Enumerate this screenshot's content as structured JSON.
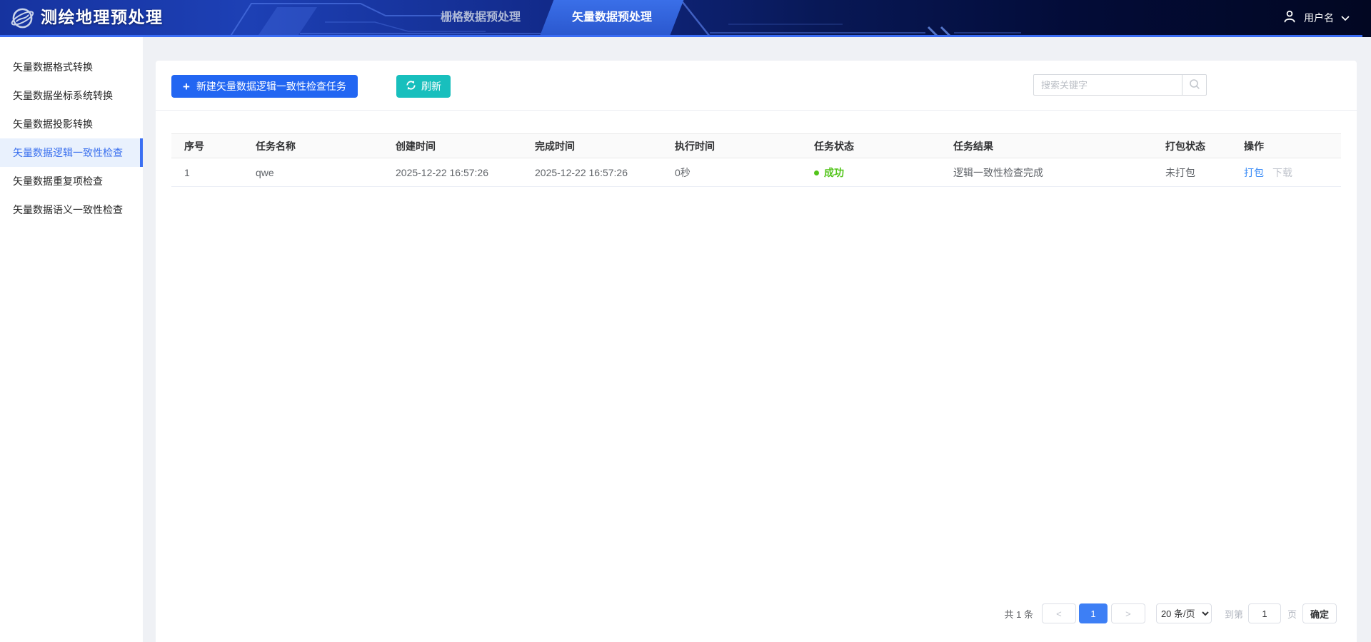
{
  "header": {
    "app_title": "测绘地理预处理",
    "tabs": [
      {
        "label": "栅格数据预处理",
        "active": false
      },
      {
        "label": "矢量数据预处理",
        "active": true
      }
    ],
    "user_name": "用户名"
  },
  "sidebar": {
    "items": [
      {
        "label": "矢量数据格式转换",
        "active": false
      },
      {
        "label": "矢量数据坐标系统转换",
        "active": false
      },
      {
        "label": "矢量数据投影转换",
        "active": false
      },
      {
        "label": "矢量数据逻辑一致性检查",
        "active": true
      },
      {
        "label": "矢量数据重复项检查",
        "active": false
      },
      {
        "label": "矢量数据语义一致性检查",
        "active": false
      }
    ]
  },
  "toolbar": {
    "new_task_label": "新建矢量数据逻辑一致性检查任务",
    "refresh_label": "刷新",
    "search_placeholder": "搜索关键字"
  },
  "table": {
    "columns": [
      "序号",
      "任务名称",
      "创建时间",
      "完成时间",
      "执行时间",
      "任务状态",
      "任务结果",
      "打包状态",
      "操作"
    ],
    "rows": [
      {
        "index": "1",
        "name": "qwe",
        "created_at": "2025-12-22 16:57:26",
        "finished_at": "2025-12-22 16:57:26",
        "duration": "0秒",
        "status": "成功",
        "result": "逻辑一致性检查完成",
        "package_status": "未打包",
        "action_package": "打包",
        "action_download": "下载"
      }
    ]
  },
  "pagination": {
    "total_label": "共 1 条",
    "prev_glyph": "<",
    "next_glyph": ">",
    "current_page": "1",
    "page_size_label": "20 条/页",
    "goto_prefix": "到第",
    "goto_value": "1",
    "goto_suffix": "页",
    "confirm_label": "确定"
  },
  "icons": {
    "plus_glyph": "+"
  },
  "colors": {
    "primary_blue": "#2266f2",
    "refresh_teal": "#18bfbd",
    "success_green": "#52c41a",
    "link_blue": "#3e8ef7",
    "active_page_blue": "#3d7ff5",
    "sidebar_active_text": "#3a70ee",
    "header_underline": "#3a6cf3"
  }
}
